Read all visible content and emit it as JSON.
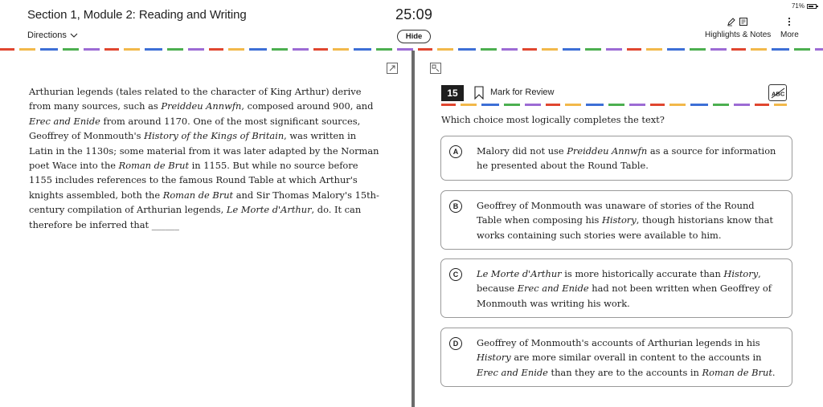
{
  "header": {
    "section_title": "Section 1, Module 2: Reading and Writing",
    "directions_label": "Directions",
    "timer": "25:09",
    "hide_label": "Hide",
    "battery": "71%",
    "highlights_label": "Highlights & Notes",
    "more_label": "More"
  },
  "passage": {
    "segments": [
      {
        "t": "Arthurian legends (tales related to the character of King Arthur) derive from many sources, such as ",
        "i": false
      },
      {
        "t": "Preiddeu Annwfn",
        "i": true
      },
      {
        "t": ", composed around 900, and ",
        "i": false
      },
      {
        "t": "Erec and Enide",
        "i": true
      },
      {
        "t": " from around 1170. One of the most significant sources, Geoffrey of Monmouth's ",
        "i": false
      },
      {
        "t": "History of the Kings of Britain",
        "i": true
      },
      {
        "t": ", was written in Latin in the 1130s; some material from it was later adapted by the Norman poet Wace into the ",
        "i": false
      },
      {
        "t": "Roman de Brut",
        "i": true
      },
      {
        "t": " in 1155. But while no source before 1155 includes references to the famous Round Table at which Arthur's knights assembled, both the ",
        "i": false
      },
      {
        "t": "Roman de Brut",
        "i": true
      },
      {
        "t": " and Sir Thomas Malory's 15th-century compilation of Arthurian legends, ",
        "i": false
      },
      {
        "t": "Le Morte d'Arthur",
        "i": true
      },
      {
        "t": ", do. It can therefore be inferred that ______",
        "i": false
      }
    ]
  },
  "question": {
    "number": "15",
    "mark_label": "Mark for Review",
    "abc_label": "ABC",
    "prompt": "Which choice most logically completes the text?"
  },
  "choices": [
    {
      "letter": "A",
      "segments": [
        {
          "t": "Malory did not use ",
          "i": false
        },
        {
          "t": "Preiddeu Annwfn",
          "i": true
        },
        {
          "t": " as a source for information he presented about the Round Table.",
          "i": false
        }
      ]
    },
    {
      "letter": "B",
      "segments": [
        {
          "t": "Geoffrey of Monmouth was unaware of stories of the Round Table when composing his ",
          "i": false
        },
        {
          "t": "History",
          "i": true
        },
        {
          "t": ", though historians know that works containing such stories were available to him.",
          "i": false
        }
      ]
    },
    {
      "letter": "C",
      "segments": [
        {
          "t": "Le Morte d'Arthur",
          "i": true
        },
        {
          "t": " is more historically accurate than ",
          "i": false
        },
        {
          "t": "History",
          "i": true
        },
        {
          "t": ", because ",
          "i": false
        },
        {
          "t": "Erec and Enide",
          "i": true
        },
        {
          "t": " had not been written when Geoffrey of Monmouth was writing his work.",
          "i": false
        }
      ]
    },
    {
      "letter": "D",
      "segments": [
        {
          "t": "Geoffrey of Monmouth's accounts of Arthurian legends in his ",
          "i": false
        },
        {
          "t": "History",
          "i": true
        },
        {
          "t": " are more similar overall in content to the accounts in ",
          "i": false
        },
        {
          "t": "Erec and Enide",
          "i": true
        },
        {
          "t": " than they are to the accounts in ",
          "i": false
        },
        {
          "t": "Roman de Brut",
          "i": true
        },
        {
          "t": ".",
          "i": false
        }
      ]
    }
  ],
  "colors": {
    "accent_dark": "#1e1e1e",
    "divider": "#6b6b6b",
    "choice_border": "#9a9a9a"
  }
}
